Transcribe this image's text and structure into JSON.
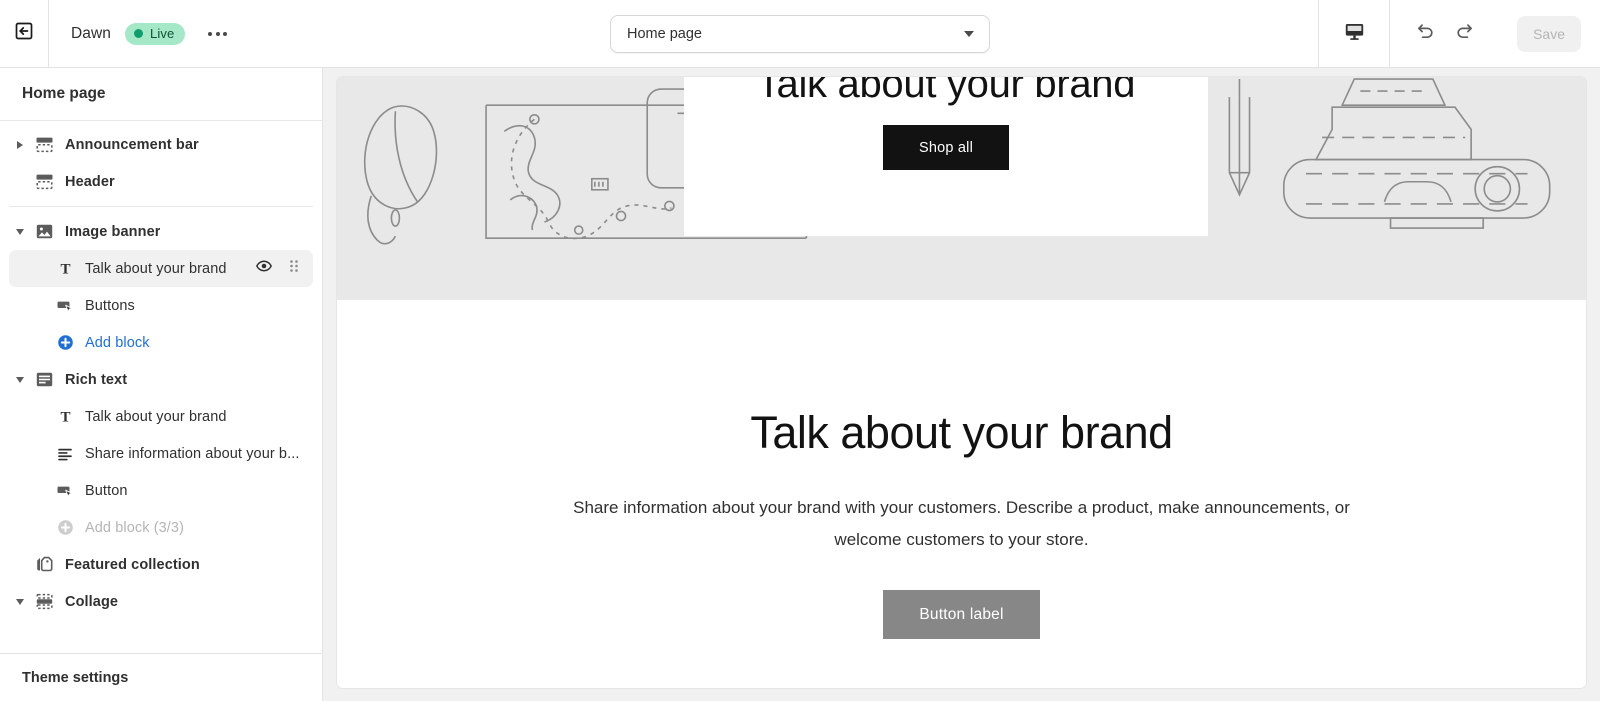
{
  "topbar": {
    "exit_icon": "exit-arrow-icon",
    "theme_name": "Dawn",
    "status_badge": "Live",
    "more_menu": "more-actions-icon",
    "page_selector": {
      "value": "Home page",
      "caret_icon": "chevron-down-icon"
    },
    "device_icon": "desktop-preview-icon",
    "undo_icon": "undo-icon",
    "redo_icon": "redo-icon",
    "save_label": "Save"
  },
  "sidebar": {
    "title": "Home page",
    "groups": [
      {
        "items": [
          {
            "label": "Announcement bar",
            "icon": "section-bar-icon",
            "kind": "section",
            "twisty": "right"
          },
          {
            "label": "Header",
            "icon": "section-bar-icon",
            "kind": "section",
            "twisty": "none"
          }
        ]
      },
      {
        "items": [
          {
            "label": "Image banner",
            "icon": "image-icon",
            "kind": "section",
            "twisty": "down"
          },
          {
            "label": "Talk about your brand",
            "icon": "text-block-icon",
            "kind": "block",
            "selected": true,
            "actions": [
              "eye-icon",
              "drag-handle-icon"
            ]
          },
          {
            "label": "Buttons",
            "icon": "button-block-icon",
            "kind": "block"
          },
          {
            "label": "Add block",
            "icon": "add-circle-icon",
            "kind": "add-block",
            "disabled": false
          },
          {
            "label": "Rich text",
            "icon": "rich-text-icon",
            "kind": "section",
            "twisty": "down"
          },
          {
            "label": "Talk about your brand",
            "icon": "text-block-icon",
            "kind": "block"
          },
          {
            "label": "Share information about your b...",
            "icon": "paragraph-block-icon",
            "kind": "block"
          },
          {
            "label": "Button",
            "icon": "button-block-icon",
            "kind": "block"
          },
          {
            "label": "Add block (3/3)",
            "icon": "add-circle-icon",
            "kind": "add-block",
            "disabled": true
          },
          {
            "label": "Featured collection",
            "icon": "collection-tag-icon",
            "kind": "section",
            "twisty": "none"
          },
          {
            "label": "Collage",
            "icon": "collage-icon",
            "kind": "section",
            "twisty": "down"
          }
        ]
      }
    ],
    "footer_label": "Theme settings"
  },
  "preview": {
    "banner": {
      "heading": "Talk about your brand",
      "button_label": "Shop all",
      "background_color": "#e8e8e8",
      "card_background": "#ffffff",
      "button_color": "#121212"
    },
    "rich_text": {
      "heading": "Talk about your brand",
      "paragraph": "Share information about your brand with your customers. Describe a product, make announcements, or welcome customers to your store.",
      "button_label": "Button label",
      "button_color": "#878787"
    }
  },
  "colors": {
    "accent_blue": "#1f6fd6",
    "badge_bg": "#a5e8c8",
    "badge_dot": "#0f9e6e",
    "badge_text": "#0c5132",
    "canvas": "#f1f1f1"
  }
}
